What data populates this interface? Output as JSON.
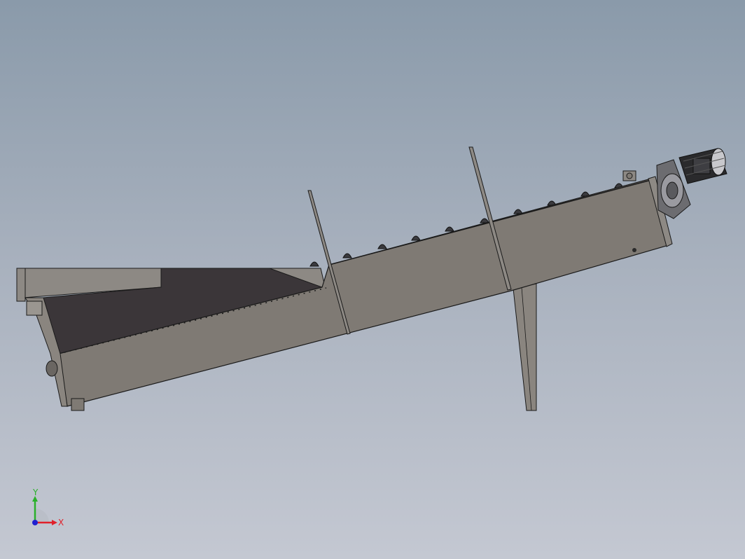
{
  "triad": {
    "x_label": "X",
    "y_label": "Y",
    "x_color": "#e0202a",
    "y_color": "#2ab02a",
    "z_color": "#2020d0"
  },
  "colors": {
    "background_top": "#8a9aaa",
    "background_bottom": "#c4c8d2",
    "trough_body": "#7f7a74",
    "trough_dark": "#3a3538",
    "outline": "#1a1a1a",
    "motor": "#2a2a2c",
    "gearbox": "#6c6c70"
  }
}
